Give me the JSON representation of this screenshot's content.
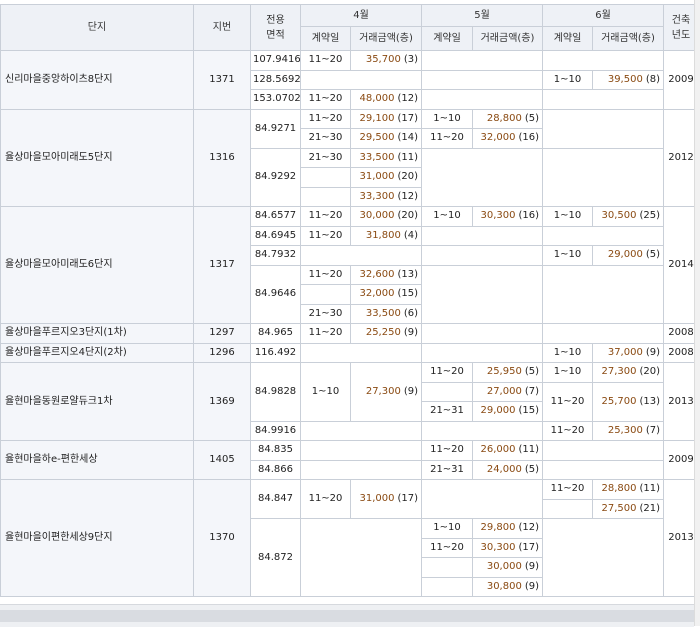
{
  "header": {
    "complex": "단지",
    "lot": "지번",
    "area": "전용\n면적",
    "months": [
      "4월",
      "5월",
      "6월"
    ],
    "contract_day": "계약일",
    "trade_amount": "거래금액(층)",
    "built_year": "건축\n년도"
  },
  "rows": [
    {
      "name": "신리마을중앙하이츠8단지",
      "lot": "1371",
      "year": "2009",
      "units": [
        {
          "area": "107.9416",
          "m4": [
            {
              "d": "11~20",
              "a": "35,700",
              "f": "(3)"
            }
          ],
          "m5": [],
          "m6": []
        },
        {
          "area": "128.5692",
          "m4": [],
          "m5": [],
          "m6": [
            {
              "d": "1~10",
              "a": "39,500",
              "f": "(8)"
            }
          ]
        },
        {
          "area": "153.0702",
          "m4": [
            {
              "d": "11~20",
              "a": "48,000",
              "f": "(12)"
            }
          ],
          "m5": [],
          "m6": []
        }
      ]
    },
    {
      "name": "율상마을모아미래도5단지",
      "lot": "1316",
      "year": "2012",
      "units": [
        {
          "area": "84.9271",
          "m4": [
            {
              "d": "11~20",
              "a": "29,100",
              "f": "(17)"
            },
            {
              "d": "21~30",
              "a": "29,500",
              "f": "(14)"
            }
          ],
          "m5": [
            {
              "d": "1~10",
              "a": "28,800",
              "f": "(5)"
            },
            {
              "d": "11~20",
              "a": "32,000",
              "f": "(16)"
            }
          ],
          "m6": []
        },
        {
          "area": "84.9292",
          "m4": [
            {
              "d": "21~30",
              "a": "33,500",
              "f": "(11)"
            },
            {
              "d": "",
              "a": "31,000",
              "f": "(20)"
            },
            {
              "d": "",
              "a": "33,300",
              "f": "(12)"
            }
          ],
          "m5": [],
          "m6": []
        }
      ]
    },
    {
      "name": "율상마을모아미래도6단지",
      "lot": "1317",
      "year": "2014",
      "units": [
        {
          "area": "84.6577",
          "m4": [
            {
              "d": "11~20",
              "a": "30,000",
              "f": "(20)"
            }
          ],
          "m5": [
            {
              "d": "1~10",
              "a": "30,300",
              "f": "(16)"
            }
          ],
          "m6": [
            {
              "d": "1~10",
              "a": "30,500",
              "f": "(25)"
            }
          ]
        },
        {
          "area": "84.6945",
          "m4": [
            {
              "d": "11~20",
              "a": "31,800",
              "f": "(4)"
            }
          ],
          "m5": [],
          "m6": []
        },
        {
          "area": "84.7932",
          "m4": [],
          "m5": [],
          "m6": [
            {
              "d": "1~10",
              "a": "29,000",
              "f": "(5)"
            }
          ]
        },
        {
          "area": "84.9646",
          "m4": [
            {
              "d": "11~20",
              "a": "32,600",
              "f": "(13)"
            },
            {
              "d": "",
              "a": "32,000",
              "f": "(15)"
            },
            {
              "d": "21~30",
              "a": "33,500",
              "f": "(6)"
            }
          ],
          "m5": [],
          "m6": []
        }
      ]
    },
    {
      "name": "율상마을푸르지오3단지(1차)",
      "lot": "1297",
      "year": "2008",
      "units": [
        {
          "area": "84.965",
          "m4": [
            {
              "d": "11~20",
              "a": "25,250",
              "f": "(9)"
            }
          ],
          "m5": [],
          "m6": []
        }
      ]
    },
    {
      "name": "율상마을푸르지오4단지(2차)",
      "lot": "1296",
      "year": "2008",
      "units": [
        {
          "area": "116.492",
          "m4": [],
          "m5": [],
          "m6": [
            {
              "d": "1~10",
              "a": "37,000",
              "f": "(9)"
            }
          ]
        }
      ]
    },
    {
      "name": "율현마을동원로얄듀크1차",
      "lot": "1369",
      "year": "2013",
      "units": [
        {
          "area": "84.9828",
          "m4": [
            {
              "d": "1~10",
              "a": "27,300",
              "f": "(9)"
            }
          ],
          "m5": [
            {
              "d": "11~20",
              "a": "25,950",
              "f": "(5)"
            },
            {
              "d": "",
              "a": "27,000",
              "f": "(7)"
            },
            {
              "d": "21~31",
              "a": "29,000",
              "f": "(15)"
            }
          ],
          "m6": [
            {
              "d": "1~10",
              "a": "27,300",
              "f": "(20)"
            },
            {
              "d": "11~20",
              "a": "25,700",
              "f": "(13)"
            }
          ]
        },
        {
          "area": "84.9916",
          "m4": [],
          "m5": [],
          "m6": [
            {
              "d": "11~20",
              "a": "25,300",
              "f": "(7)"
            }
          ]
        }
      ]
    },
    {
      "name": "율현마을하e-편한세상",
      "lot": "1405",
      "year": "2009",
      "units": [
        {
          "area": "84.835",
          "m4": [],
          "m5": [
            {
              "d": "11~20",
              "a": "26,000",
              "f": "(11)"
            }
          ],
          "m6": []
        },
        {
          "area": "84.866",
          "m4": [],
          "m5": [
            {
              "d": "21~31",
              "a": "24,000",
              "f": "(5)"
            }
          ],
          "m6": []
        }
      ]
    },
    {
      "name": "율현마을이편한세상9단지",
      "lot": "1370",
      "year": "2013",
      "units": [
        {
          "area": "84.847",
          "m4": [
            {
              "d": "11~20",
              "a": "31,000",
              "f": "(17)"
            }
          ],
          "m5": [],
          "m6": [
            {
              "d": "11~20",
              "a": "28,800",
              "f": "(11)"
            },
            {
              "d": "",
              "a": "27,500",
              "f": "(21)"
            }
          ]
        },
        {
          "area": "84.872",
          "m4": [],
          "m5": [
            {
              "d": "1~10",
              "a": "29,800",
              "f": "(12)"
            },
            {
              "d": "11~20",
              "a": "30,300",
              "f": "(17)"
            },
            {
              "d": "",
              "a": "30,000",
              "f": "(9)"
            },
            {
              "d": "",
              "a": "30,800",
              "f": "(9)"
            }
          ],
          "m6": []
        }
      ]
    }
  ],
  "colors": {
    "header_bg": "#eef1f6",
    "border": "#c9cfd8",
    "amount_brown": "#8a4a12",
    "name_bg": "#f4f6fa"
  }
}
